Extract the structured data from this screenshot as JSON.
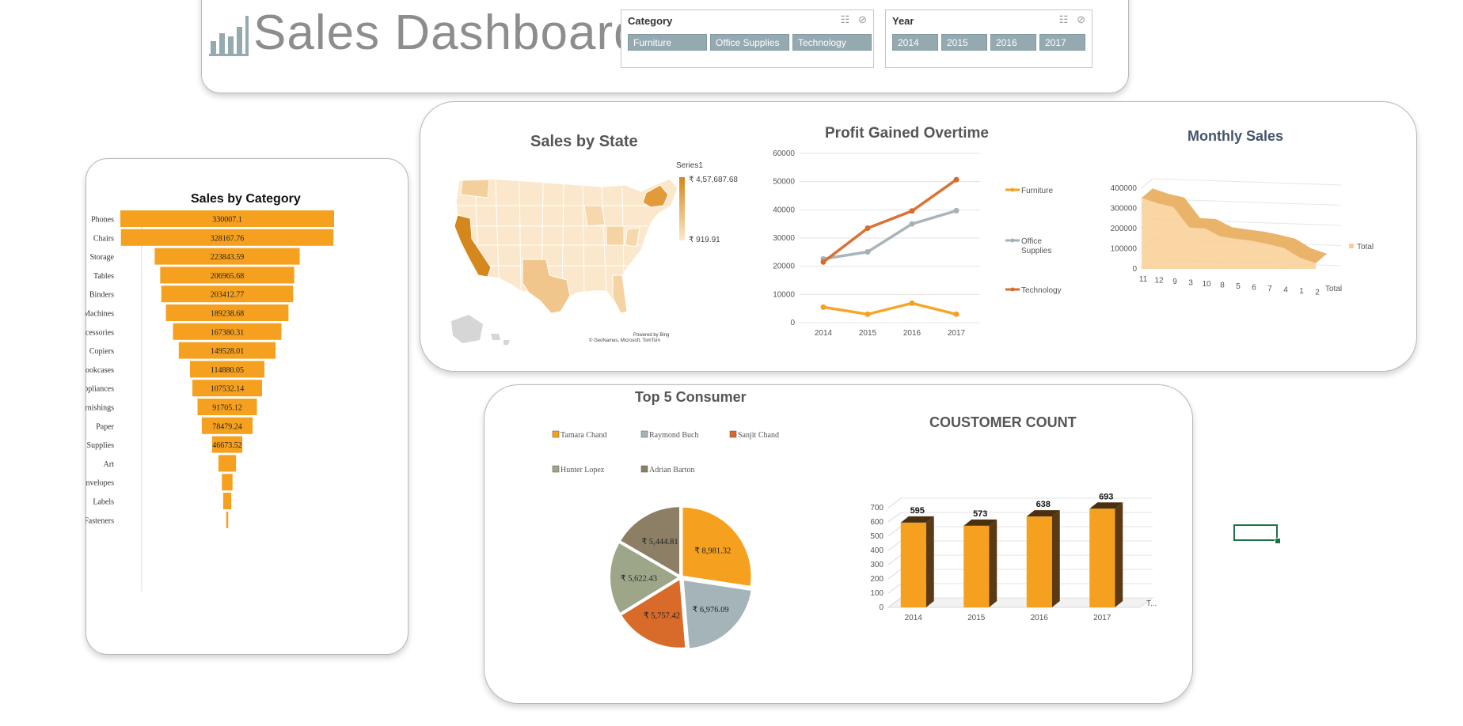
{
  "header": {
    "title": "Sales Dashboard"
  },
  "slicers": {
    "category": {
      "title": "Category",
      "items": [
        "Furniture",
        "Office Supplies",
        "Technology"
      ]
    },
    "year": {
      "title": "Year",
      "items": [
        "2014",
        "2015",
        "2016",
        "2017"
      ]
    }
  },
  "map": {
    "title": "Sales by State",
    "legend_title": "Series1",
    "max_label": "₹ 4,57,687.68",
    "min_label": "₹ 919.91",
    "credit1": "Powered by Bing",
    "credit2": "© GeoNames, Microsoft, TomTom",
    "colors": {
      "low": "#fbe8cc",
      "high": "#d4871c",
      "other": "#d6d6d6"
    }
  },
  "charts": {
    "sales_by_category": {
      "title": "Sales by Category",
      "color": "#f5a11f"
    },
    "profit_overtime": {
      "title": "Profit Gained Overtime"
    },
    "monthly_sales": {
      "title": "Monthly Sales",
      "axis_label": "Total",
      "legend": "Total"
    },
    "top5_consumer": {
      "title": "Top 5 Consumer"
    },
    "customer_count": {
      "title": "COUSTOMER COUNT",
      "legend": "T..."
    }
  },
  "chart_data": [
    {
      "type": "bar",
      "title": "Sales by Category",
      "categories": [
        "Phones",
        "Chairs",
        "Storage",
        "Tables",
        "Binders",
        "Machines",
        "Accessories",
        "Copiers",
        "Bookcases",
        "Appliances",
        "Furnishings",
        "Paper",
        "Supplies",
        "Art",
        "Envelopes",
        "Labels",
        "Fasteners"
      ],
      "values": [
        330007.1,
        328167.76,
        223843.59,
        206965.68,
        203412.77,
        189238.68,
        167380.31,
        149528.01,
        114880.05,
        107532.14,
        91705.12,
        78479.24,
        46673.52,
        27118.79,
        16476.4,
        12486.31,
        3024.28
      ],
      "value_labels": [
        "330007.1",
        "328167.76",
        "223843.59",
        "206965.68",
        "203412.77",
        "189238.68",
        "167380.31",
        "149528.01",
        "114880.05",
        "107532.14",
        "91705.12",
        "78479.24",
        "46673.52",
        "",
        "",
        "",
        ""
      ]
    },
    {
      "type": "line",
      "title": "Profit Gained Overtime",
      "x": [
        "2014",
        "2015",
        "2016",
        "2017"
      ],
      "yticks": [
        "0",
        "10000",
        "20000",
        "30000",
        "40000",
        "50000",
        "60000"
      ],
      "ylim": [
        0,
        60000
      ],
      "series": [
        {
          "name": "Furniture",
          "values": [
            5500,
            3000,
            6900,
            3000
          ],
          "color": "#f5a11f"
        },
        {
          "name": "Office Supplies",
          "values": [
            22600,
            25100,
            35000,
            39700
          ],
          "color": "#a4b1b6"
        },
        {
          "name": "Technology",
          "values": [
            21500,
            33500,
            39600,
            50700
          ],
          "color": "#d86a2a"
        }
      ]
    },
    {
      "type": "area",
      "title": "Monthly Sales",
      "categories": [
        "11",
        "12",
        "9",
        "3",
        "10",
        "8",
        "5",
        "6",
        "7",
        "4",
        "1",
        "2"
      ],
      "values": [
        352000,
        325000,
        307000,
        205000,
        200000,
        160000,
        148000,
        138000,
        122000,
        103000,
        55000,
        28000
      ],
      "yticks": [
        "0",
        "100000",
        "200000",
        "300000",
        "400000"
      ],
      "ylim": [
        0,
        400000
      ],
      "legend": [
        "Total"
      ],
      "color": "#f8cf93"
    },
    {
      "type": "pie",
      "title": "Top 5 Consumer",
      "legend": [
        "Tamara Chand",
        "Raymond Buch",
        "Sanjit Chand",
        "Hunter Lopez",
        "Adrian Barton"
      ],
      "slices": [
        {
          "name": "Tamara Chand",
          "value": 8981.32,
          "label": "₹ 8,981.32",
          "color": "#f5a11f"
        },
        {
          "name": "Raymond Buch",
          "value": 6976.09,
          "label": "₹ 6,976.09",
          "color": "#a4b4b9"
        },
        {
          "name": "Sanjit Chand",
          "value": 5757.42,
          "label": "₹ 5,757.42",
          "color": "#d86a2a"
        },
        {
          "name": "Hunter Lopez",
          "value": 5622.43,
          "label": "₹ 5,622.43",
          "color": "#9ea68a"
        },
        {
          "name": "Adrian Barton",
          "value": 5444.81,
          "label": "₹ 5,444.81",
          "color": "#8c7f66"
        }
      ]
    },
    {
      "type": "bar",
      "title": "COUSTOMER COUNT",
      "categories": [
        "2014",
        "2015",
        "2016",
        "2017"
      ],
      "values": [
        595,
        573,
        638,
        693
      ],
      "yticks": [
        "0",
        "100",
        "200",
        "300",
        "400",
        "500",
        "600",
        "700"
      ],
      "ylim": [
        0,
        700
      ],
      "color": "#f5a11f"
    }
  ]
}
